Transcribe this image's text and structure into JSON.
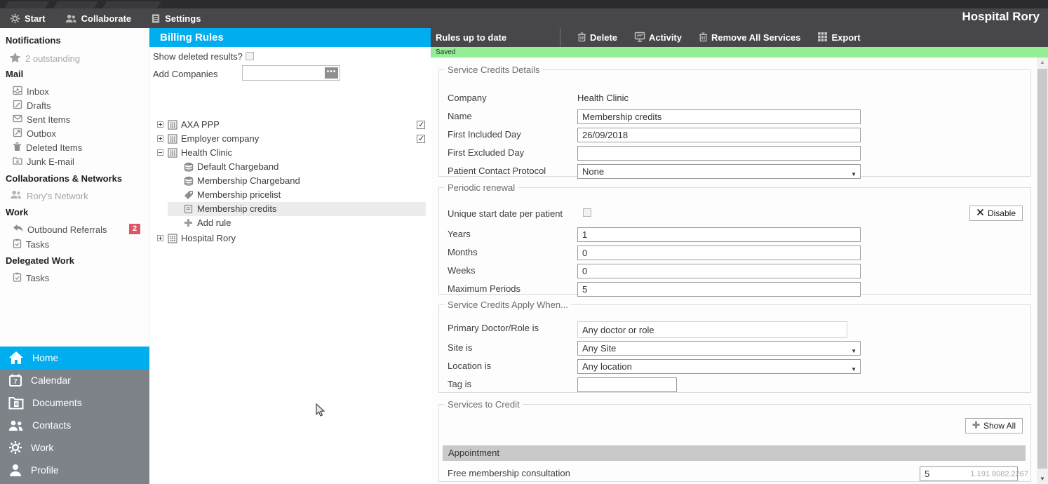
{
  "app": {
    "title": "Hospital Rory",
    "version": "1.191.8082.2267"
  },
  "topbar": {
    "start": "Start",
    "collaborate": "Collaborate",
    "settings": "Settings"
  },
  "sidebar": {
    "notifications_title": "Notifications",
    "notifications_item": "2 outstanding",
    "mail_title": "Mail",
    "mail_items": [
      {
        "label": "Inbox"
      },
      {
        "label": "Drafts"
      },
      {
        "label": "Sent Items"
      },
      {
        "label": "Outbox"
      },
      {
        "label": "Deleted Items"
      },
      {
        "label": "Junk E-mail"
      }
    ],
    "collab_title": "Collaborations & Networks",
    "collab_item": "Rory's Network",
    "work_title": "Work",
    "work_items": [
      {
        "label": "Outbound Referrals",
        "badge": "2"
      },
      {
        "label": "Tasks"
      }
    ],
    "delegated_title": "Delegated Work",
    "delegated_items": [
      {
        "label": "Tasks"
      }
    ],
    "nav": [
      {
        "label": "Home"
      },
      {
        "label": "Calendar"
      },
      {
        "label": "Documents"
      },
      {
        "label": "Contacts"
      },
      {
        "label": "Work"
      },
      {
        "label": "Profile"
      }
    ]
  },
  "billing": {
    "title": "Billing Rules",
    "show_deleted_label": "Show deleted results?",
    "add_companies_label": "Add Companies",
    "tree": {
      "companies": [
        {
          "label": "AXA PPP"
        },
        {
          "label": "Employer company"
        },
        {
          "label": "Health Clinic"
        },
        {
          "label": "Hospital Rory"
        }
      ],
      "health_clinic_children": [
        {
          "label": "Default Chargeband"
        },
        {
          "label": "Membership Chargeband"
        },
        {
          "label": "Membership pricelist"
        },
        {
          "label": "Membership credits"
        },
        {
          "label": "Add rule"
        }
      ]
    }
  },
  "rules_bar": {
    "status": "Rules up to date",
    "delete": "Delete",
    "activity": "Activity",
    "remove_all": "Remove All Services",
    "export": "Export"
  },
  "saved_banner": "Saved",
  "details": {
    "legend": "Service Credits Details",
    "company_label": "Company",
    "company_value": "Health Clinic",
    "name_label": "Name",
    "name_value": "Membership credits",
    "first_included_label": "First Included Day",
    "first_included_value": "26/09/2018",
    "first_excluded_label": "First Excluded Day",
    "first_excluded_value": "",
    "protocol_label": "Patient Contact Protocol",
    "protocol_value": "None"
  },
  "periodic": {
    "legend": "Periodic renewal",
    "unique_label": "Unique start date per patient",
    "disable_button": "Disable",
    "years_label": "Years",
    "years_value": "1",
    "months_label": "Months",
    "months_value": "0",
    "weeks_label": "Weeks",
    "weeks_value": "0",
    "max_label": "Maximum Periods",
    "max_value": "5"
  },
  "apply_when": {
    "legend": "Service Credits Apply When...",
    "doctor_label": "Primary Doctor/Role is",
    "doctor_value": "Any doctor or role",
    "site_label": "Site is",
    "site_value": "Any Site",
    "location_label": "Location is",
    "location_value": "Any location",
    "tag_label": "Tag is",
    "tag_value": ""
  },
  "services": {
    "legend": "Services to Credit",
    "show_all_button": "Show All",
    "group_header": "Appointment",
    "rows": [
      {
        "label": "Free membership consultation",
        "value": "5"
      }
    ]
  },
  "colors": {
    "accent": "#00AEEF",
    "saved_green": "#94ee94",
    "badge_red": "#dd5864",
    "toolbar_gray": "#47474a"
  }
}
